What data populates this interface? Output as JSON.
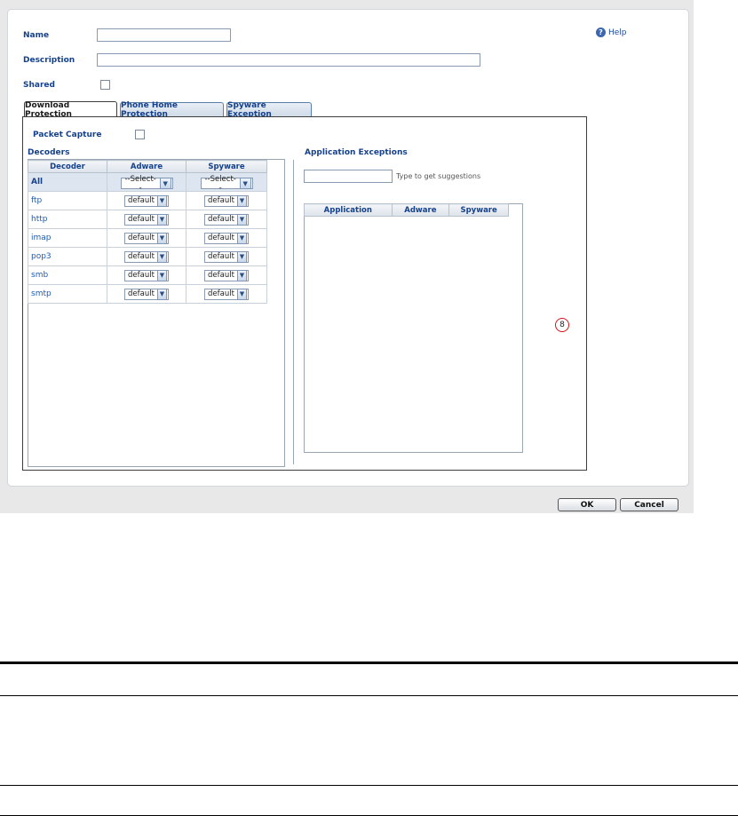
{
  "form": {
    "name_label": "Name",
    "name_value": "",
    "description_label": "Description",
    "description_value": "",
    "shared_label": "Shared",
    "help_label": "Help"
  },
  "tabs": [
    {
      "label": "Download Protection",
      "active": true
    },
    {
      "label": "Phone Home Protection",
      "active": false
    },
    {
      "label": "Spyware Exception",
      "active": false
    }
  ],
  "download_protection": {
    "packet_capture_label": "Packet Capture",
    "decoders_title": "Decoders",
    "columns": [
      "Decoder",
      "Adware",
      "Spyware"
    ],
    "all_row": {
      "decoder": "All",
      "adware": "--Select--",
      "spyware": "--Select--"
    },
    "rows": [
      {
        "decoder": "ftp",
        "adware": "default",
        "spyware": "default"
      },
      {
        "decoder": "http",
        "adware": "default",
        "spyware": "default"
      },
      {
        "decoder": "imap",
        "adware": "default",
        "spyware": "default"
      },
      {
        "decoder": "pop3",
        "adware": "default",
        "spyware": "default"
      },
      {
        "decoder": "smb",
        "adware": "default",
        "spyware": "default"
      },
      {
        "decoder": "smtp",
        "adware": "default",
        "spyware": "default"
      }
    ],
    "app_exceptions_title": "Application Exceptions",
    "app_search_value": "",
    "app_search_hint": "Type to get suggestions",
    "app_columns": [
      "Application",
      "Adware",
      "Spyware"
    ]
  },
  "callout_number": "8",
  "buttons": {
    "ok": "OK",
    "cancel": "Cancel"
  },
  "colors": {
    "label_blue": "#15418c",
    "link_blue": "#1d5bb1",
    "callout_red": "#d0151b"
  }
}
